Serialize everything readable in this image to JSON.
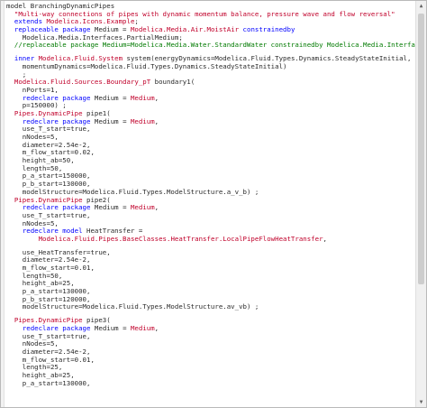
{
  "editor": {
    "lines": [
      [
        {
          "t": "model BranchingDynamicPipes",
          "c": ""
        }
      ],
      [
        {
          "t": "  ",
          "c": ""
        },
        {
          "t": "\"Multi-way connections of pipes with dynamic momentum balance, pressure wave and flow reversal\"",
          "c": "str"
        }
      ],
      [
        {
          "t": "  ",
          "c": ""
        },
        {
          "t": "extends",
          "c": "kw"
        },
        {
          "t": " ",
          "c": ""
        },
        {
          "t": "Modelica.Icons.Example",
          "c": "ty"
        },
        {
          "t": ";",
          "c": ""
        }
      ],
      [
        {
          "t": "  ",
          "c": ""
        },
        {
          "t": "replaceable package",
          "c": "kw"
        },
        {
          "t": " Medium = ",
          "c": ""
        },
        {
          "t": "Modelica.Media.Air.MoistAir",
          "c": "ty"
        },
        {
          "t": " ",
          "c": ""
        },
        {
          "t": "constrainedby",
          "c": "kw"
        }
      ],
      [
        {
          "t": "    Modelica.Media.Interfaces.PartialMedium;",
          "c": ""
        }
      ],
      [
        {
          "t": "  ",
          "c": ""
        },
        {
          "t": "//replaceable package Medium=Modelica.Media.Water.StandardWater constrainedby Modelica.Media.Interfaces.PartialMedium;",
          "c": "cm"
        }
      ],
      {
        "blank": true
      },
      [
        {
          "t": "  ",
          "c": ""
        },
        {
          "t": "inner",
          "c": "kw"
        },
        {
          "t": " ",
          "c": ""
        },
        {
          "t": "Modelica.Fluid.System",
          "c": "ty"
        },
        {
          "t": " system(energyDynamics=Modelica.Fluid.Types.Dynamics.SteadyStateInitial,",
          "c": ""
        }
      ],
      [
        {
          "t": "    momentumDynamics=Modelica.Fluid.Types.Dynamics.SteadyStateInitial)",
          "c": ""
        }
      ],
      [
        {
          "t": "    ;",
          "c": ""
        }
      ],
      [
        {
          "t": "  ",
          "c": ""
        },
        {
          "t": "Modelica.Fluid.Sources.Boundary_pT",
          "c": "ty"
        },
        {
          "t": " boundary1(",
          "c": ""
        }
      ],
      [
        {
          "t": "    nPorts=1,",
          "c": ""
        }
      ],
      [
        {
          "t": "    ",
          "c": ""
        },
        {
          "t": "redeclare package",
          "c": "kw"
        },
        {
          "t": " Medium = ",
          "c": ""
        },
        {
          "t": "Medium",
          "c": "ty"
        },
        {
          "t": ",",
          "c": ""
        }
      ],
      [
        {
          "t": "    p=150000) ;",
          "c": ""
        }
      ],
      [
        {
          "t": "  ",
          "c": ""
        },
        {
          "t": "Pipes.DynamicPipe",
          "c": "ty"
        },
        {
          "t": " pipe1(",
          "c": ""
        }
      ],
      [
        {
          "t": "    ",
          "c": ""
        },
        {
          "t": "redeclare package",
          "c": "kw"
        },
        {
          "t": " Medium = ",
          "c": ""
        },
        {
          "t": "Medium",
          "c": "ty"
        },
        {
          "t": ",",
          "c": ""
        }
      ],
      [
        {
          "t": "    use_T_start=true,",
          "c": ""
        }
      ],
      [
        {
          "t": "    nNodes=5,",
          "c": ""
        }
      ],
      [
        {
          "t": "    diameter=2.54e-2,",
          "c": ""
        }
      ],
      [
        {
          "t": "    m_flow_start=0.02,",
          "c": ""
        }
      ],
      [
        {
          "t": "    height_ab=50,",
          "c": ""
        }
      ],
      [
        {
          "t": "    length=50,",
          "c": ""
        }
      ],
      [
        {
          "t": "    p_a_start=150000,",
          "c": ""
        }
      ],
      [
        {
          "t": "    p_b_start=130000,",
          "c": ""
        }
      ],
      [
        {
          "t": "    modelStructure=Modelica.Fluid.Types.ModelStructure.a_v_b) ;",
          "c": ""
        }
      ],
      [
        {
          "t": "  ",
          "c": ""
        },
        {
          "t": "Pipes.DynamicPipe",
          "c": "ty"
        },
        {
          "t": " pipe2(",
          "c": ""
        }
      ],
      [
        {
          "t": "    ",
          "c": ""
        },
        {
          "t": "redeclare package",
          "c": "kw"
        },
        {
          "t": " Medium = ",
          "c": ""
        },
        {
          "t": "Medium",
          "c": "ty"
        },
        {
          "t": ",",
          "c": ""
        }
      ],
      [
        {
          "t": "    use_T_start=true,",
          "c": ""
        }
      ],
      [
        {
          "t": "    nNodes=5,",
          "c": ""
        }
      ],
      [
        {
          "t": "    ",
          "c": ""
        },
        {
          "t": "redeclare model",
          "c": "kw"
        },
        {
          "t": " HeatTransfer =",
          "c": ""
        }
      ],
      [
        {
          "t": "        ",
          "c": ""
        },
        {
          "t": "Modelica.Fluid.Pipes.BaseClasses.HeatTransfer.LocalPipeFlowHeatTransfer",
          "c": "ty"
        },
        {
          "t": ",",
          "c": ""
        }
      ],
      {
        "blank": true
      },
      [
        {
          "t": "    use_HeatTransfer=true,",
          "c": ""
        }
      ],
      [
        {
          "t": "    diameter=2.54e-2,",
          "c": ""
        }
      ],
      [
        {
          "t": "    m_flow_start=0.01,",
          "c": ""
        }
      ],
      [
        {
          "t": "    length=50,",
          "c": ""
        }
      ],
      [
        {
          "t": "    height_ab=25,",
          "c": ""
        }
      ],
      [
        {
          "t": "    p_a_start=130000,",
          "c": ""
        }
      ],
      [
        {
          "t": "    p_b_start=120000,",
          "c": ""
        }
      ],
      [
        {
          "t": "    modelStructure=Modelica.Fluid.Types.ModelStructure.av_vb) ;",
          "c": ""
        }
      ],
      {
        "blank": true
      },
      [
        {
          "t": "  ",
          "c": ""
        },
        {
          "t": "Pipes.DynamicPipe",
          "c": "ty"
        },
        {
          "t": " pipe3(",
          "c": ""
        }
      ],
      [
        {
          "t": "    ",
          "c": ""
        },
        {
          "t": "redeclare package",
          "c": "kw"
        },
        {
          "t": " Medium = ",
          "c": ""
        },
        {
          "t": "Medium",
          "c": "ty"
        },
        {
          "t": ",",
          "c": ""
        }
      ],
      [
        {
          "t": "    use_T_start=true,",
          "c": ""
        }
      ],
      [
        {
          "t": "    nNodes=5,",
          "c": ""
        }
      ],
      [
        {
          "t": "    diameter=2.54e-2,",
          "c": ""
        }
      ],
      [
        {
          "t": "    m_flow_start=0.01,",
          "c": ""
        }
      ],
      [
        {
          "t": "    length=25,",
          "c": ""
        }
      ],
      [
        {
          "t": "    height_ab=25,",
          "c": ""
        }
      ],
      [
        {
          "t": "    p_a_start=130000,",
          "c": ""
        }
      ]
    ]
  },
  "scrollbar": {
    "up_arrow": "▲",
    "down_arrow": "▼"
  },
  "colors": {
    "keyword": "#0000ff",
    "type": "#c0002a",
    "string": "#c0002a",
    "comment": "#007a00",
    "text": "#2a2a2a"
  }
}
